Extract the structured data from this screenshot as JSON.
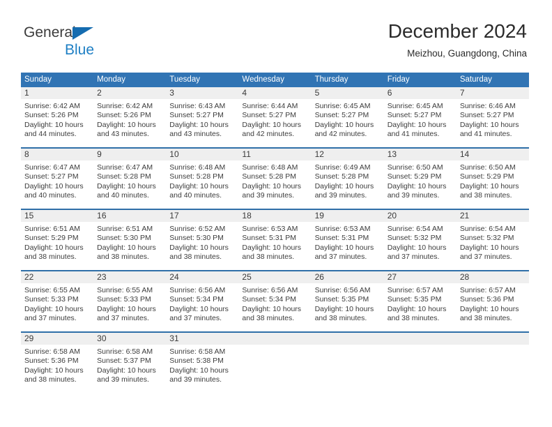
{
  "brand": {
    "name_part1": "General",
    "name_part2": "Blue",
    "triangle_color": "#156cb0"
  },
  "header": {
    "title": "December 2024",
    "subtitle": "Meizhou, Guangdong, China"
  },
  "theme": {
    "header_blue": "#3174b4",
    "row_divider_blue": "#2f6fa8",
    "daynum_band": "#efefef"
  },
  "calendar": {
    "weekday_headers": [
      "Sunday",
      "Monday",
      "Tuesday",
      "Wednesday",
      "Thursday",
      "Friday",
      "Saturday"
    ],
    "weeks": [
      [
        {
          "day": "1",
          "sunrise": "Sunrise: 6:42 AM",
          "sunset": "Sunset: 5:26 PM",
          "daylight_line1": "Daylight: 10 hours",
          "daylight_line2": "and 44 minutes."
        },
        {
          "day": "2",
          "sunrise": "Sunrise: 6:42 AM",
          "sunset": "Sunset: 5:26 PM",
          "daylight_line1": "Daylight: 10 hours",
          "daylight_line2": "and 43 minutes."
        },
        {
          "day": "3",
          "sunrise": "Sunrise: 6:43 AM",
          "sunset": "Sunset: 5:27 PM",
          "daylight_line1": "Daylight: 10 hours",
          "daylight_line2": "and 43 minutes."
        },
        {
          "day": "4",
          "sunrise": "Sunrise: 6:44 AM",
          "sunset": "Sunset: 5:27 PM",
          "daylight_line1": "Daylight: 10 hours",
          "daylight_line2": "and 42 minutes."
        },
        {
          "day": "5",
          "sunrise": "Sunrise: 6:45 AM",
          "sunset": "Sunset: 5:27 PM",
          "daylight_line1": "Daylight: 10 hours",
          "daylight_line2": "and 42 minutes."
        },
        {
          "day": "6",
          "sunrise": "Sunrise: 6:45 AM",
          "sunset": "Sunset: 5:27 PM",
          "daylight_line1": "Daylight: 10 hours",
          "daylight_line2": "and 41 minutes."
        },
        {
          "day": "7",
          "sunrise": "Sunrise: 6:46 AM",
          "sunset": "Sunset: 5:27 PM",
          "daylight_line1": "Daylight: 10 hours",
          "daylight_line2": "and 41 minutes."
        }
      ],
      [
        {
          "day": "8",
          "sunrise": "Sunrise: 6:47 AM",
          "sunset": "Sunset: 5:27 PM",
          "daylight_line1": "Daylight: 10 hours",
          "daylight_line2": "and 40 minutes."
        },
        {
          "day": "9",
          "sunrise": "Sunrise: 6:47 AM",
          "sunset": "Sunset: 5:28 PM",
          "daylight_line1": "Daylight: 10 hours",
          "daylight_line2": "and 40 minutes."
        },
        {
          "day": "10",
          "sunrise": "Sunrise: 6:48 AM",
          "sunset": "Sunset: 5:28 PM",
          "daylight_line1": "Daylight: 10 hours",
          "daylight_line2": "and 40 minutes."
        },
        {
          "day": "11",
          "sunrise": "Sunrise: 6:48 AM",
          "sunset": "Sunset: 5:28 PM",
          "daylight_line1": "Daylight: 10 hours",
          "daylight_line2": "and 39 minutes."
        },
        {
          "day": "12",
          "sunrise": "Sunrise: 6:49 AM",
          "sunset": "Sunset: 5:28 PM",
          "daylight_line1": "Daylight: 10 hours",
          "daylight_line2": "and 39 minutes."
        },
        {
          "day": "13",
          "sunrise": "Sunrise: 6:50 AM",
          "sunset": "Sunset: 5:29 PM",
          "daylight_line1": "Daylight: 10 hours",
          "daylight_line2": "and 39 minutes."
        },
        {
          "day": "14",
          "sunrise": "Sunrise: 6:50 AM",
          "sunset": "Sunset: 5:29 PM",
          "daylight_line1": "Daylight: 10 hours",
          "daylight_line2": "and 38 minutes."
        }
      ],
      [
        {
          "day": "15",
          "sunrise": "Sunrise: 6:51 AM",
          "sunset": "Sunset: 5:29 PM",
          "daylight_line1": "Daylight: 10 hours",
          "daylight_line2": "and 38 minutes."
        },
        {
          "day": "16",
          "sunrise": "Sunrise: 6:51 AM",
          "sunset": "Sunset: 5:30 PM",
          "daylight_line1": "Daylight: 10 hours",
          "daylight_line2": "and 38 minutes."
        },
        {
          "day": "17",
          "sunrise": "Sunrise: 6:52 AM",
          "sunset": "Sunset: 5:30 PM",
          "daylight_line1": "Daylight: 10 hours",
          "daylight_line2": "and 38 minutes."
        },
        {
          "day": "18",
          "sunrise": "Sunrise: 6:53 AM",
          "sunset": "Sunset: 5:31 PM",
          "daylight_line1": "Daylight: 10 hours",
          "daylight_line2": "and 38 minutes."
        },
        {
          "day": "19",
          "sunrise": "Sunrise: 6:53 AM",
          "sunset": "Sunset: 5:31 PM",
          "daylight_line1": "Daylight: 10 hours",
          "daylight_line2": "and 37 minutes."
        },
        {
          "day": "20",
          "sunrise": "Sunrise: 6:54 AM",
          "sunset": "Sunset: 5:32 PM",
          "daylight_line1": "Daylight: 10 hours",
          "daylight_line2": "and 37 minutes."
        },
        {
          "day": "21",
          "sunrise": "Sunrise: 6:54 AM",
          "sunset": "Sunset: 5:32 PM",
          "daylight_line1": "Daylight: 10 hours",
          "daylight_line2": "and 37 minutes."
        }
      ],
      [
        {
          "day": "22",
          "sunrise": "Sunrise: 6:55 AM",
          "sunset": "Sunset: 5:33 PM",
          "daylight_line1": "Daylight: 10 hours",
          "daylight_line2": "and 37 minutes."
        },
        {
          "day": "23",
          "sunrise": "Sunrise: 6:55 AM",
          "sunset": "Sunset: 5:33 PM",
          "daylight_line1": "Daylight: 10 hours",
          "daylight_line2": "and 37 minutes."
        },
        {
          "day": "24",
          "sunrise": "Sunrise: 6:56 AM",
          "sunset": "Sunset: 5:34 PM",
          "daylight_line1": "Daylight: 10 hours",
          "daylight_line2": "and 37 minutes."
        },
        {
          "day": "25",
          "sunrise": "Sunrise: 6:56 AM",
          "sunset": "Sunset: 5:34 PM",
          "daylight_line1": "Daylight: 10 hours",
          "daylight_line2": "and 38 minutes."
        },
        {
          "day": "26",
          "sunrise": "Sunrise: 6:56 AM",
          "sunset": "Sunset: 5:35 PM",
          "daylight_line1": "Daylight: 10 hours",
          "daylight_line2": "and 38 minutes."
        },
        {
          "day": "27",
          "sunrise": "Sunrise: 6:57 AM",
          "sunset": "Sunset: 5:35 PM",
          "daylight_line1": "Daylight: 10 hours",
          "daylight_line2": "and 38 minutes."
        },
        {
          "day": "28",
          "sunrise": "Sunrise: 6:57 AM",
          "sunset": "Sunset: 5:36 PM",
          "daylight_line1": "Daylight: 10 hours",
          "daylight_line2": "and 38 minutes."
        }
      ],
      [
        {
          "day": "29",
          "sunrise": "Sunrise: 6:58 AM",
          "sunset": "Sunset: 5:36 PM",
          "daylight_line1": "Daylight: 10 hours",
          "daylight_line2": "and 38 minutes."
        },
        {
          "day": "30",
          "sunrise": "Sunrise: 6:58 AM",
          "sunset": "Sunset: 5:37 PM",
          "daylight_line1": "Daylight: 10 hours",
          "daylight_line2": "and 39 minutes."
        },
        {
          "day": "31",
          "sunrise": "Sunrise: 6:58 AM",
          "sunset": "Sunset: 5:38 PM",
          "daylight_line1": "Daylight: 10 hours",
          "daylight_line2": "and 39 minutes."
        },
        {
          "day": "",
          "sunrise": "",
          "sunset": "",
          "daylight_line1": "",
          "daylight_line2": ""
        },
        {
          "day": "",
          "sunrise": "",
          "sunset": "",
          "daylight_line1": "",
          "daylight_line2": ""
        },
        {
          "day": "",
          "sunrise": "",
          "sunset": "",
          "daylight_line1": "",
          "daylight_line2": ""
        },
        {
          "day": "",
          "sunrise": "",
          "sunset": "",
          "daylight_line1": "",
          "daylight_line2": ""
        }
      ]
    ]
  }
}
